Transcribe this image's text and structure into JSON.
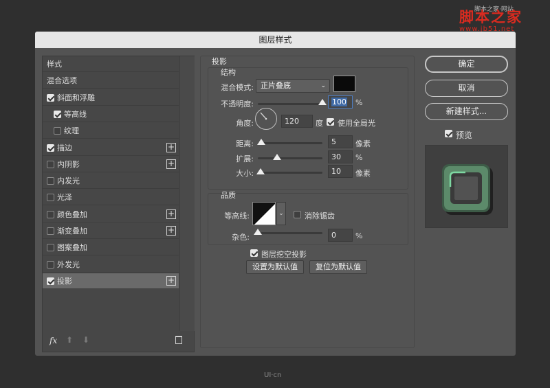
{
  "watermark": {
    "site_label": "脚本之家·网站",
    "logo": "脚本之家",
    "url": "www.jb51.net",
    "footer": "UI·cn"
  },
  "dialog": {
    "title": "图层样式"
  },
  "sidebar": {
    "items": [
      {
        "label": "样式",
        "checkbox": null,
        "plus": false,
        "indent": 0
      },
      {
        "label": "混合选项",
        "checkbox": null,
        "plus": false,
        "indent": 0
      },
      {
        "label": "斜面和浮雕",
        "checkbox": true,
        "plus": false,
        "indent": 0
      },
      {
        "label": "等高线",
        "checkbox": true,
        "plus": false,
        "indent": 1
      },
      {
        "label": "纹理",
        "checkbox": false,
        "plus": false,
        "indent": 1
      },
      {
        "label": "描边",
        "checkbox": true,
        "plus": true,
        "indent": 0
      },
      {
        "label": "内阴影",
        "checkbox": false,
        "plus": true,
        "indent": 0
      },
      {
        "label": "内发光",
        "checkbox": false,
        "plus": false,
        "indent": 0
      },
      {
        "label": "光泽",
        "checkbox": false,
        "plus": false,
        "indent": 0
      },
      {
        "label": "颜色叠加",
        "checkbox": false,
        "plus": true,
        "indent": 0
      },
      {
        "label": "渐变叠加",
        "checkbox": false,
        "plus": true,
        "indent": 0
      },
      {
        "label": "图案叠加",
        "checkbox": false,
        "plus": false,
        "indent": 0
      },
      {
        "label": "外发光",
        "checkbox": false,
        "plus": false,
        "indent": 0
      },
      {
        "label": "投影",
        "checkbox": true,
        "plus": true,
        "indent": 0,
        "selected": true
      }
    ],
    "footer": {
      "fx_label": "fx",
      "up_icon": "arrow-up-icon",
      "down_icon": "arrow-down-icon",
      "delete_icon": "trash-icon"
    }
  },
  "panel": {
    "section_title": "投影",
    "structure": {
      "title": "结构",
      "blend_mode_label": "混合模式:",
      "blend_mode_value": "正片叠底",
      "shadow_color": "#0a0a0a",
      "opacity_label": "不透明度:",
      "opacity_value": "100",
      "opacity_unit": "%",
      "opacity_level": 1.0,
      "angle_label": "角度:",
      "angle_value": "120",
      "angle_unit": "度",
      "global_light_label": "使用全局光",
      "global_light_checked": true,
      "distance_label": "距离:",
      "distance_value": "5",
      "distance_unit": "像素",
      "distance_level": 0.05,
      "spread_label": "扩展:",
      "spread_value": "30",
      "spread_unit": "%",
      "spread_level": 0.3,
      "size_label": "大小:",
      "size_value": "10",
      "size_unit": "像素",
      "size_level": 0.04
    },
    "quality": {
      "title": "品质",
      "contour_label": "等高线:",
      "anti_alias_label": "消除锯齿",
      "anti_alias_checked": false,
      "noise_label": "杂色:",
      "noise_value": "0",
      "noise_unit": "%",
      "noise_level": 0.0
    },
    "knockout_label": "图层挖空投影",
    "knockout_checked": true,
    "set_default_label": "设置为默认值",
    "reset_default_label": "复位为默认值"
  },
  "actions": {
    "ok_label": "确定",
    "cancel_label": "取消",
    "new_style_label": "新建样式...",
    "preview_label": "预览",
    "preview_checked": true
  }
}
